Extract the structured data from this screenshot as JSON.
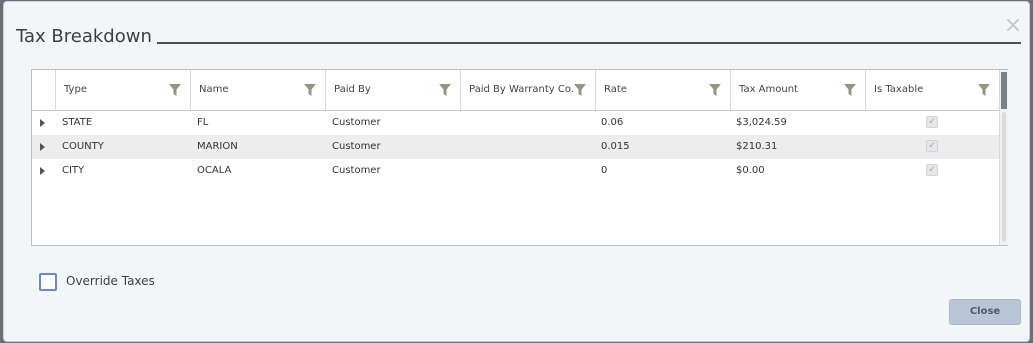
{
  "dialog": {
    "title": "Tax Breakdown",
    "close_icon": "close-icon"
  },
  "grid": {
    "columns": [
      {
        "label": "Type"
      },
      {
        "label": "Name"
      },
      {
        "label": "Paid By"
      },
      {
        "label": "Paid By Warranty Co."
      },
      {
        "label": "Rate"
      },
      {
        "label": "Tax Amount"
      },
      {
        "label": "Is Taxable"
      }
    ],
    "rows": [
      {
        "type": "STATE",
        "name": "FL",
        "paid_by": "Customer",
        "paid_by_warranty": "",
        "rate": "0.06",
        "tax_amount": "$3,024.59",
        "is_taxable": true
      },
      {
        "type": "COUNTY",
        "name": "MARION",
        "paid_by": "Customer",
        "paid_by_warranty": "",
        "rate": "0.015",
        "tax_amount": "$210.31",
        "is_taxable": true
      },
      {
        "type": "CITY",
        "name": "OCALA",
        "paid_by": "Customer",
        "paid_by_warranty": "",
        "rate": "0",
        "tax_amount": "$0.00",
        "is_taxable": true
      }
    ]
  },
  "override": {
    "label": "Override Taxes",
    "checked": false
  },
  "footer": {
    "close_label": "Close"
  },
  "colors": {
    "accent": "#6f88c9",
    "filter_icon": "#8d9a7a",
    "close_button_bg": "#b9c6d6"
  }
}
